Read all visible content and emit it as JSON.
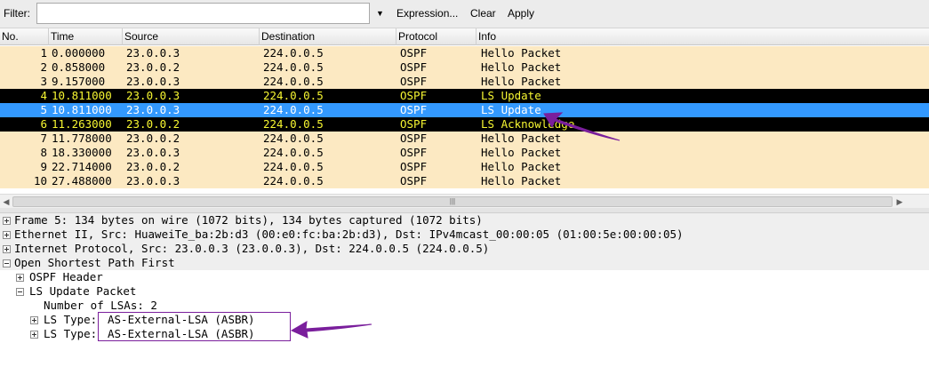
{
  "toolbar": {
    "filter_label": "Filter:",
    "filter_value": "",
    "filter_dropdown_glyph": "▼",
    "expression_label": "Expression...",
    "clear_label": "Clear",
    "apply_label": "Apply"
  },
  "packet_list": {
    "columns": [
      "No.",
      "Time",
      "Source",
      "Destination",
      "Protocol",
      "Info"
    ],
    "rows": [
      {
        "no": "1",
        "time": "0.000000",
        "source": "23.0.0.3",
        "destination": "224.0.0.5",
        "protocol": "OSPF",
        "info": "Hello Packet"
      },
      {
        "no": "2",
        "time": "0.858000",
        "source": "23.0.0.2",
        "destination": "224.0.0.5",
        "protocol": "OSPF",
        "info": "Hello Packet"
      },
      {
        "no": "3",
        "time": "9.157000",
        "source": "23.0.0.3",
        "destination": "224.0.0.5",
        "protocol": "OSPF",
        "info": "Hello Packet"
      },
      {
        "no": "4",
        "time": "10.811000",
        "source": "23.0.0.3",
        "destination": "224.0.0.5",
        "protocol": "OSPF",
        "info": "LS Update"
      },
      {
        "no": "5",
        "time": "10.811000",
        "source": "23.0.0.3",
        "destination": "224.0.0.5",
        "protocol": "OSPF",
        "info": "LS Update"
      },
      {
        "no": "6",
        "time": "11.263000",
        "source": "23.0.0.2",
        "destination": "224.0.0.5",
        "protocol": "OSPF",
        "info": "LS Acknowledge"
      },
      {
        "no": "7",
        "time": "11.778000",
        "source": "23.0.0.2",
        "destination": "224.0.0.5",
        "protocol": "OSPF",
        "info": "Hello Packet"
      },
      {
        "no": "8",
        "time": "18.330000",
        "source": "23.0.0.3",
        "destination": "224.0.0.5",
        "protocol": "OSPF",
        "info": "Hello Packet"
      },
      {
        "no": "9",
        "time": "22.714000",
        "source": "23.0.0.2",
        "destination": "224.0.0.5",
        "protocol": "OSPF",
        "info": "Hello Packet"
      },
      {
        "no": "10",
        "time": "27.488000",
        "source": "23.0.0.3",
        "destination": "224.0.0.5",
        "protocol": "OSPF",
        "info": "Hello Packet"
      }
    ],
    "selected_row": 5,
    "colors": {
      "normal_bg": "#fce9c2",
      "lsu_bg": "#000000",
      "lsu_fg": "#f6f631",
      "selected_bg": "#3399ff",
      "selected_fg": "#ffffff"
    }
  },
  "scrollbar": {
    "left_arrow_glyph": "◀",
    "right_arrow_glyph": "▶",
    "grip_glyph": "|||"
  },
  "details": {
    "frame": "Frame 5: 134 bytes on wire (1072 bits), 134 bytes captured (1072 bits)",
    "ethernet": "Ethernet II, Src: HuaweiTe_ba:2b:d3 (00:e0:fc:ba:2b:d3), Dst: IPv4mcast_00:00:05 (01:00:5e:00:00:05)",
    "ip": "Internet Protocol, Src: 23.0.0.3 (23.0.0.3), Dst: 224.0.0.5 (224.0.0.5)",
    "ospf": "Open Shortest Path First",
    "ospf_header": "OSPF Header",
    "ls_update_packet": "LS Update Packet",
    "number_of_lsas": "Number of LSAs: 2",
    "ls_type_label": "LS Type:",
    "ls_type_1_value": "AS-External-LSA (ASBR)",
    "ls_type_2_value": "AS-External-LSA (ASBR)"
  },
  "annotations": {
    "color": "#7a1f9c"
  }
}
